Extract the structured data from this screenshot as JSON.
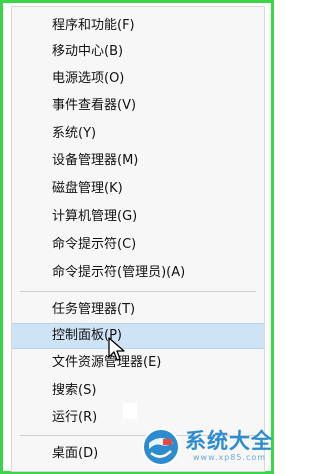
{
  "menu": {
    "items": [
      {
        "label": "程序和功能(F)"
      },
      {
        "label": "移动中心(B)"
      },
      {
        "label": "电源选项(O)"
      },
      {
        "label": "事件查看器(V)"
      },
      {
        "label": "系统(Y)"
      },
      {
        "label": "设备管理器(M)"
      },
      {
        "label": "磁盘管理(K)"
      },
      {
        "label": "计算机管理(G)"
      },
      {
        "label": "命令提示符(C)"
      },
      {
        "label": "命令提示符(管理员)(A)"
      },
      {
        "label": "任务管理器(T)"
      },
      {
        "label": "控制面板(P)",
        "highlighted": true
      },
      {
        "label": "文件资源管理器(E)"
      },
      {
        "label": "搜索(S)"
      },
      {
        "label": "运行(R)"
      },
      {
        "label": "桌面(D)"
      }
    ]
  },
  "watermark": {
    "title": "系统大全",
    "url": "www.xp85.com"
  },
  "colors": {
    "frame": "#3ad64a",
    "highlight": "#cfe3f7",
    "watermark": "#2d8bd0"
  }
}
